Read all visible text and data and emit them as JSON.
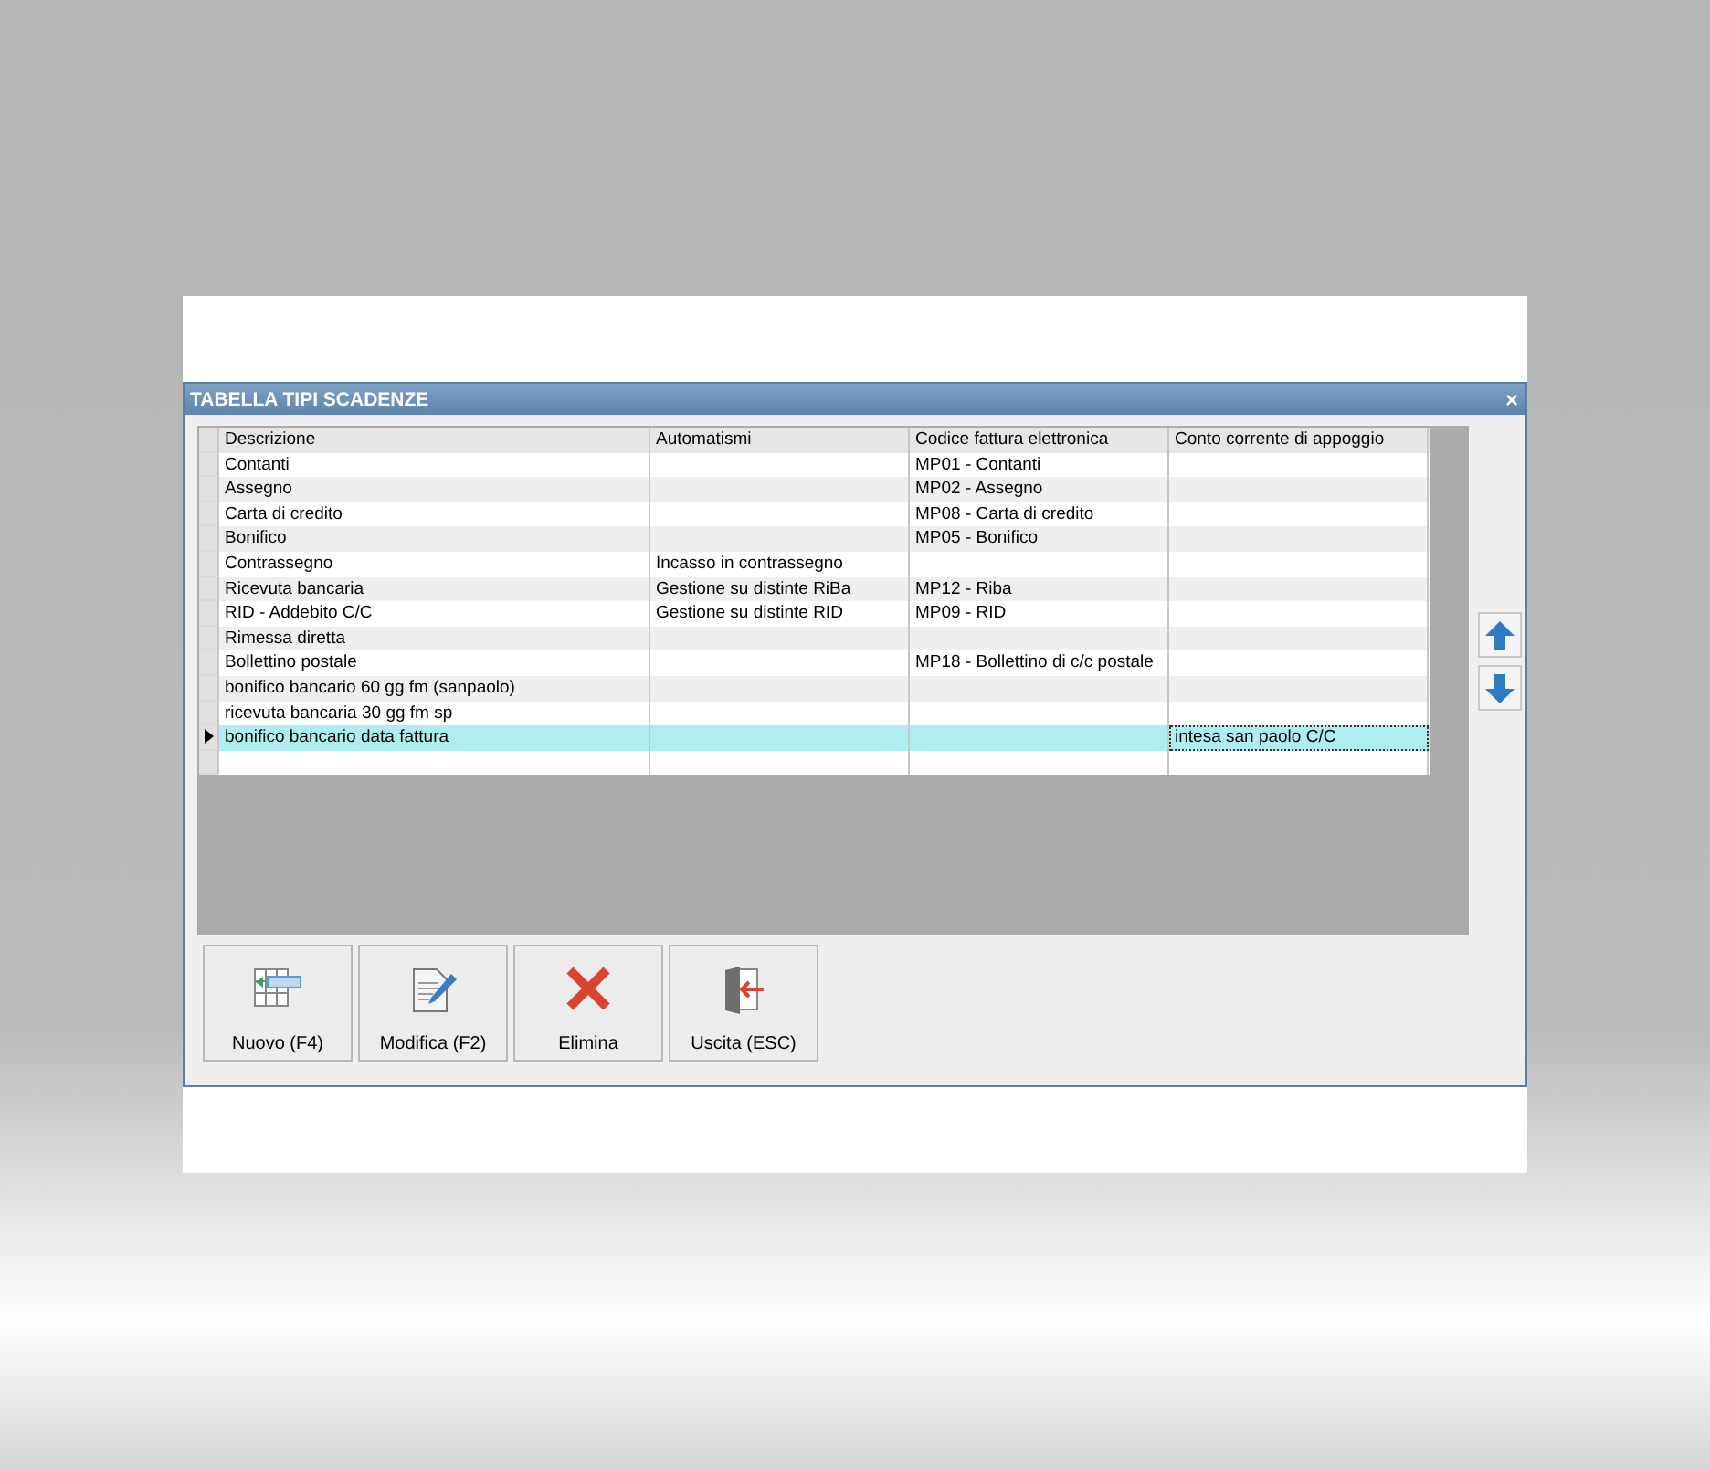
{
  "window": {
    "title": "TABELLA TIPI SCADENZE",
    "close": "×"
  },
  "table": {
    "columns": [
      "Descrizione",
      "Automatismi",
      "Codice fattura elettronica",
      "Conto corrente di appoggio"
    ],
    "rows": [
      {
        "selected": false,
        "conto_focused": false,
        "descrizione": "Contanti",
        "codice": "MP01 - Contanti"
      },
      {
        "selected": false,
        "conto_focused": false,
        "descrizione": "Assegno",
        "codice": "MP02 - Assegno"
      },
      {
        "selected": false,
        "conto_focused": false,
        "descrizione": "Carta di credito",
        "codice": "MP08 - Carta di credito"
      },
      {
        "selected": false,
        "conto_focused": false,
        "descrizione": "Bonifico",
        "codice": "MP05 - Bonifico"
      },
      {
        "selected": false,
        "conto_focused": false,
        "descrizione": "Contrassegno",
        "automatismi": "Incasso in contrassegno"
      },
      {
        "selected": false,
        "conto_focused": false,
        "descrizione": "Ricevuta bancaria",
        "automatismi": "Gestione su distinte RiBa",
        "codice": "MP12 - Riba"
      },
      {
        "selected": false,
        "conto_focused": false,
        "descrizione": "RID - Addebito C/C",
        "automatismi": "Gestione su distinte RID",
        "codice": "MP09 - RID"
      },
      {
        "selected": false,
        "conto_focused": false,
        "descrizione": "Rimessa diretta"
      },
      {
        "selected": false,
        "conto_focused": false,
        "descrizione": "Bollettino postale",
        "codice": "MP18 - Bollettino di c/c postale"
      },
      {
        "selected": false,
        "conto_focused": false,
        "descrizione": "bonifico bancario 60 gg fm (sanpaolo)"
      },
      {
        "selected": false,
        "conto_focused": false,
        "descrizione": "ricevuta bancaria 30 gg fm sp"
      },
      {
        "selected": true,
        "conto_focused": true,
        "descrizione": "bonifico bancario data fattura",
        "conto": "intesa san paolo C/C"
      }
    ]
  },
  "buttons": [
    {
      "kind": "new",
      "label": "Nuovo (F4)"
    },
    {
      "kind": "edit",
      "label": "Modifica (F2)"
    },
    {
      "kind": "delete",
      "label": "Elimina"
    },
    {
      "kind": "exit",
      "label": "Uscita (ESC)"
    }
  ]
}
